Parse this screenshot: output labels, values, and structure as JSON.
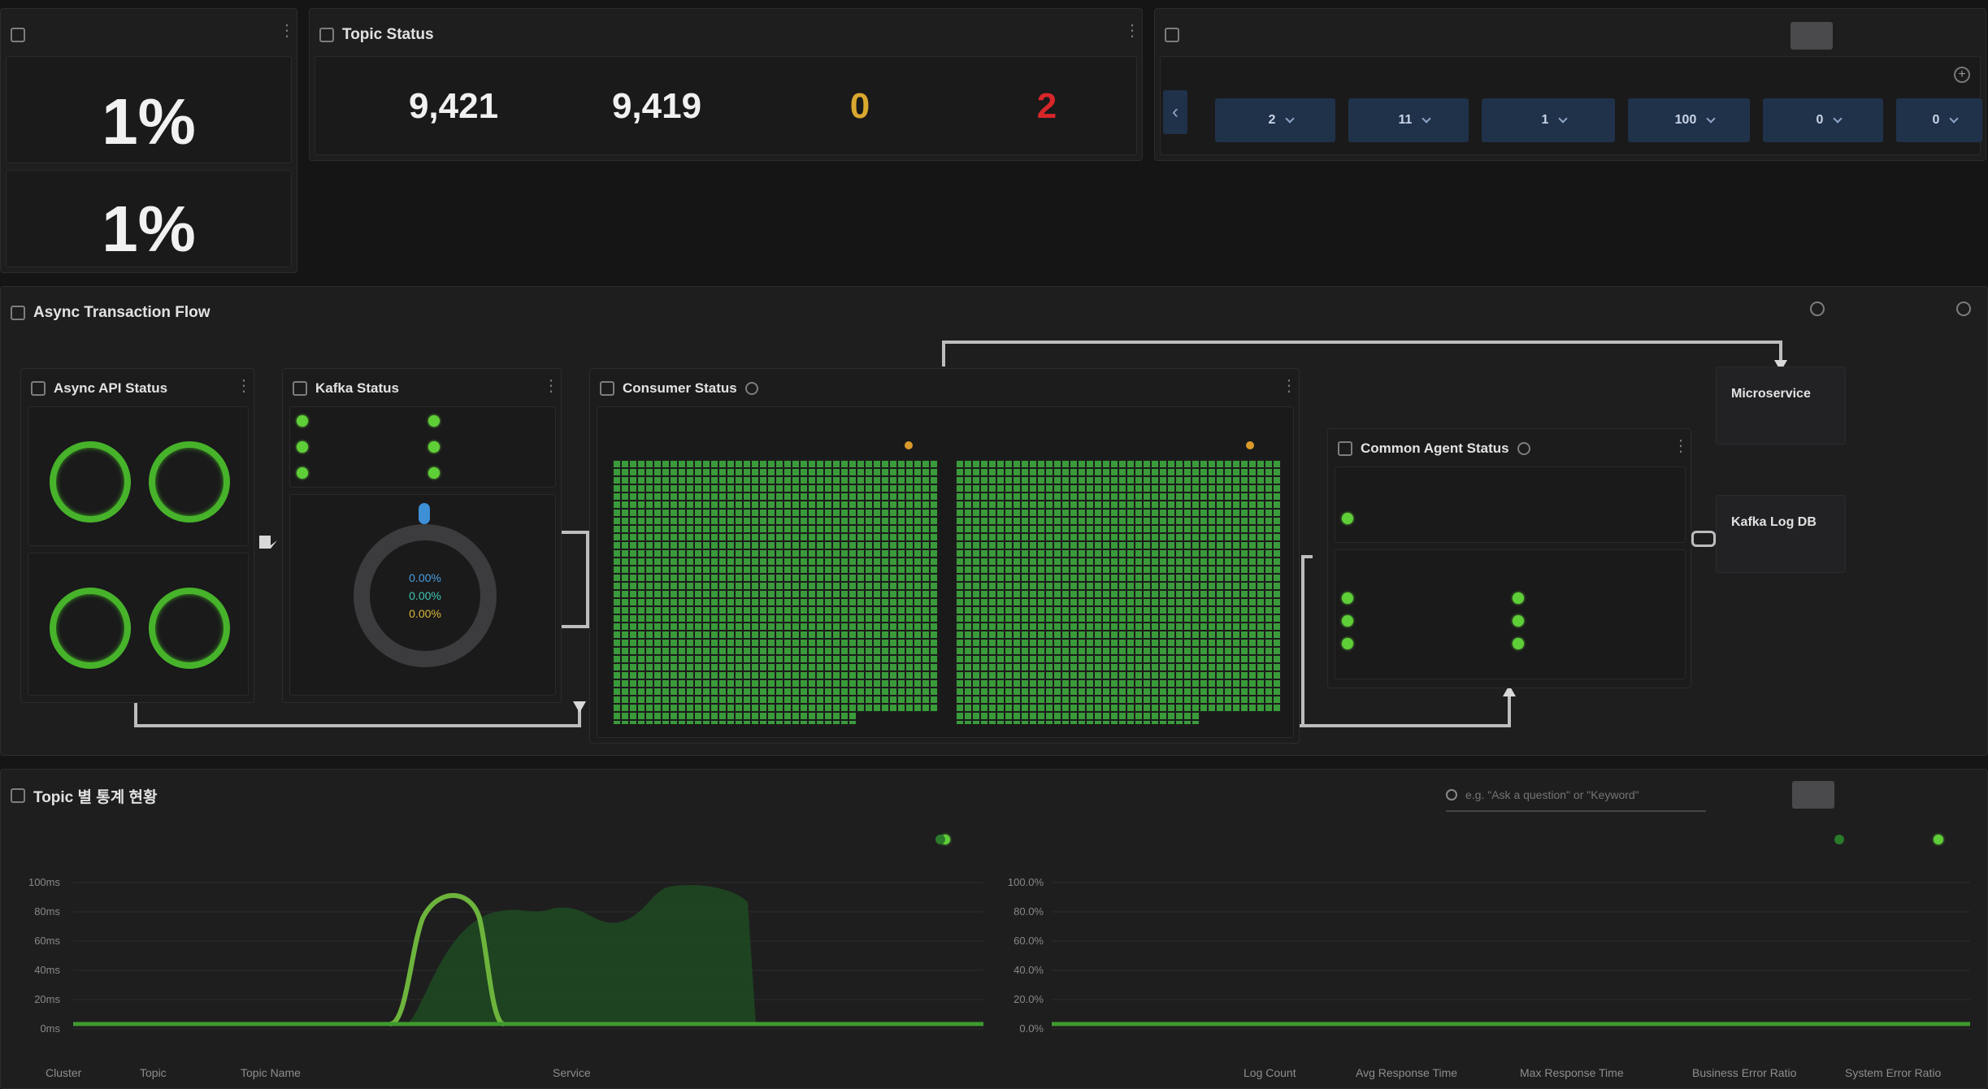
{
  "top_left": {
    "title": "",
    "items": [
      {
        "label": "",
        "value": "1%"
      },
      {
        "label": "",
        "value": "1%"
      }
    ]
  },
  "topic_status": {
    "title": "Topic Status",
    "metrics": [
      {
        "label": "",
        "value": "9,421",
        "color": "#e8e8e8"
      },
      {
        "label": "",
        "value": "9,419",
        "color": "#e8e8e8"
      },
      {
        "label": "",
        "value": "0",
        "color": "#d9a82e"
      },
      {
        "label": "",
        "value": "2",
        "color": "#d8262a"
      }
    ]
  },
  "top_right": {
    "title": "",
    "time_options": [
      "",
      "",
      "",
      ""
    ],
    "pills": [
      {
        "label": "",
        "value": "2"
      },
      {
        "label": "",
        "value": "11"
      },
      {
        "label": "",
        "value": "1"
      },
      {
        "label": "",
        "value": "100"
      },
      {
        "label": "",
        "value": "0"
      },
      {
        "label": "",
        "value": "0"
      }
    ]
  },
  "flow": {
    "title": "Async Transaction Flow",
    "zoom_out_label": "",
    "zoom_in_label": "",
    "async_api": {
      "title": "Async API Status"
    },
    "kafka": {
      "title": "Kafka Status",
      "topics": [
        "",
        "",
        "",
        "",
        "",
        ""
      ],
      "donut_values": [
        "0.00%",
        "0.00%",
        "0.00%"
      ]
    },
    "consumer": {
      "title": "Consumer Status"
    },
    "agent": {
      "title": "Common Agent Status",
      "section2_items": [
        "",
        "",
        "",
        "",
        "",
        ""
      ]
    },
    "microservice": {
      "title": "Microservice"
    },
    "kafka_log_db": {
      "title": "Kafka Log DB"
    }
  },
  "bottom": {
    "title": "Topic 별 통계 현황",
    "search_placeholder": "e.g. \"Ask a question\" or \"Keyword\"",
    "time_options": [
      "",
      "",
      "",
      ""
    ],
    "left_chart_title": "",
    "right_chart_title": "",
    "y_labels_left": [
      "100ms",
      "80ms",
      "60ms",
      "40ms",
      "20ms",
      "0ms"
    ],
    "y_labels_right": [
      "100.0%",
      "80.0%",
      "60.0%",
      "40.0%",
      "20.0%",
      "0.0%"
    ],
    "x_labels": [
      "",
      "",
      "",
      "",
      "",
      "",
      "",
      "",
      "",
      "",
      "",
      ""
    ],
    "columns_left": [
      "Cluster",
      "Topic",
      "Topic Name",
      "Service"
    ],
    "columns_right": [
      "Log Count",
      "Avg Response Time",
      "Max Response Time",
      "Business Error Ratio",
      "System Error Ratio"
    ]
  },
  "chart_data": [
    {
      "type": "area",
      "title": "",
      "series": [
        {
          "name": "",
          "color": "#6db43c",
          "x": [
            0,
            1,
            2,
            3,
            4,
            5,
            6,
            7,
            8,
            9,
            10,
            11
          ],
          "values": [
            0,
            0,
            0,
            0,
            0,
            0,
            0,
            0,
            0,
            0,
            0,
            0
          ]
        }
      ],
      "ylim": [
        0,
        100
      ],
      "y_ticks": [
        "100ms",
        "80ms",
        "60ms",
        "40ms",
        "20ms",
        "0ms"
      ]
    },
    {
      "type": "line",
      "title": "",
      "series": [],
      "ylim": [
        0,
        100
      ],
      "y_ticks": [
        "100.0%",
        "80.0%",
        "60.0%",
        "40.0%",
        "20.0%",
        "0.0%"
      ]
    }
  ]
}
